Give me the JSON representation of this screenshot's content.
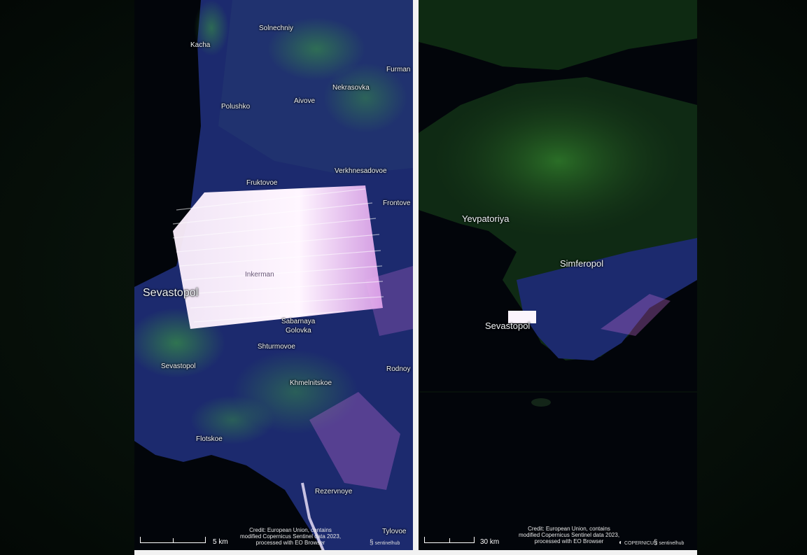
{
  "left_panel": {
    "places": [
      {
        "id": "solnechniy",
        "text": "Solnechniy"
      },
      {
        "id": "kacha",
        "text": "Kacha"
      },
      {
        "id": "furman",
        "text": "Furman"
      },
      {
        "id": "nekrasovka",
        "text": "Nekrasovka"
      },
      {
        "id": "polushko",
        "text": "Polushko"
      },
      {
        "id": "aivove",
        "text": "Aivove"
      },
      {
        "id": "verkhnesadovoe",
        "text": "Verkhnesadovoe"
      },
      {
        "id": "fruktovoe",
        "text": "Fruktovoe"
      },
      {
        "id": "frontove",
        "text": "Frontove"
      },
      {
        "id": "inkerman",
        "text": "Inkerman"
      },
      {
        "id": "sevastopol-big",
        "text": "Sevastopol"
      },
      {
        "id": "sabarnaya",
        "text": "Sabarnaya"
      },
      {
        "id": "golovka",
        "text": "Golovka"
      },
      {
        "id": "shturmovoe",
        "text": "Shturmovoe"
      },
      {
        "id": "sevastopol-small",
        "text": "Sevastopol"
      },
      {
        "id": "rodnoy",
        "text": "Rodnoy"
      },
      {
        "id": "khmelnitskoe",
        "text": "Khmelnitskoe"
      },
      {
        "id": "flotskoe",
        "text": "Flotskoe"
      },
      {
        "id": "rezervnoye",
        "text": "Rezervnoye"
      },
      {
        "id": "tylovoe",
        "text": "Tylovoe"
      }
    ],
    "scale_label": "5 km",
    "credit": "Credit: European Union, contains modified Copernicus Sentinel data 2023, processed with EO Browser",
    "logo_text": "sentinelhub"
  },
  "right_panel": {
    "places": [
      {
        "id": "yevpatoriya",
        "text": "Yevpatoriya"
      },
      {
        "id": "simferopol",
        "text": "Simferopol"
      },
      {
        "id": "sevastopol",
        "text": "Sevastopol"
      }
    ],
    "scale_label": "30 km",
    "credit": "Credit: European Union, contains modified Copernicus Sentinel data 2023, processed with EO Browser",
    "logo_copernicus": "COPERNICUS",
    "logo_sentinelhub": "sentinelhub"
  },
  "colors": {
    "land_blue": "#1c2a6e",
    "vegetation_green": "#3fae3a",
    "glare_white": "#fbeefc",
    "glare_pink": "#e08ae8",
    "sea_dark": "#02050a"
  }
}
